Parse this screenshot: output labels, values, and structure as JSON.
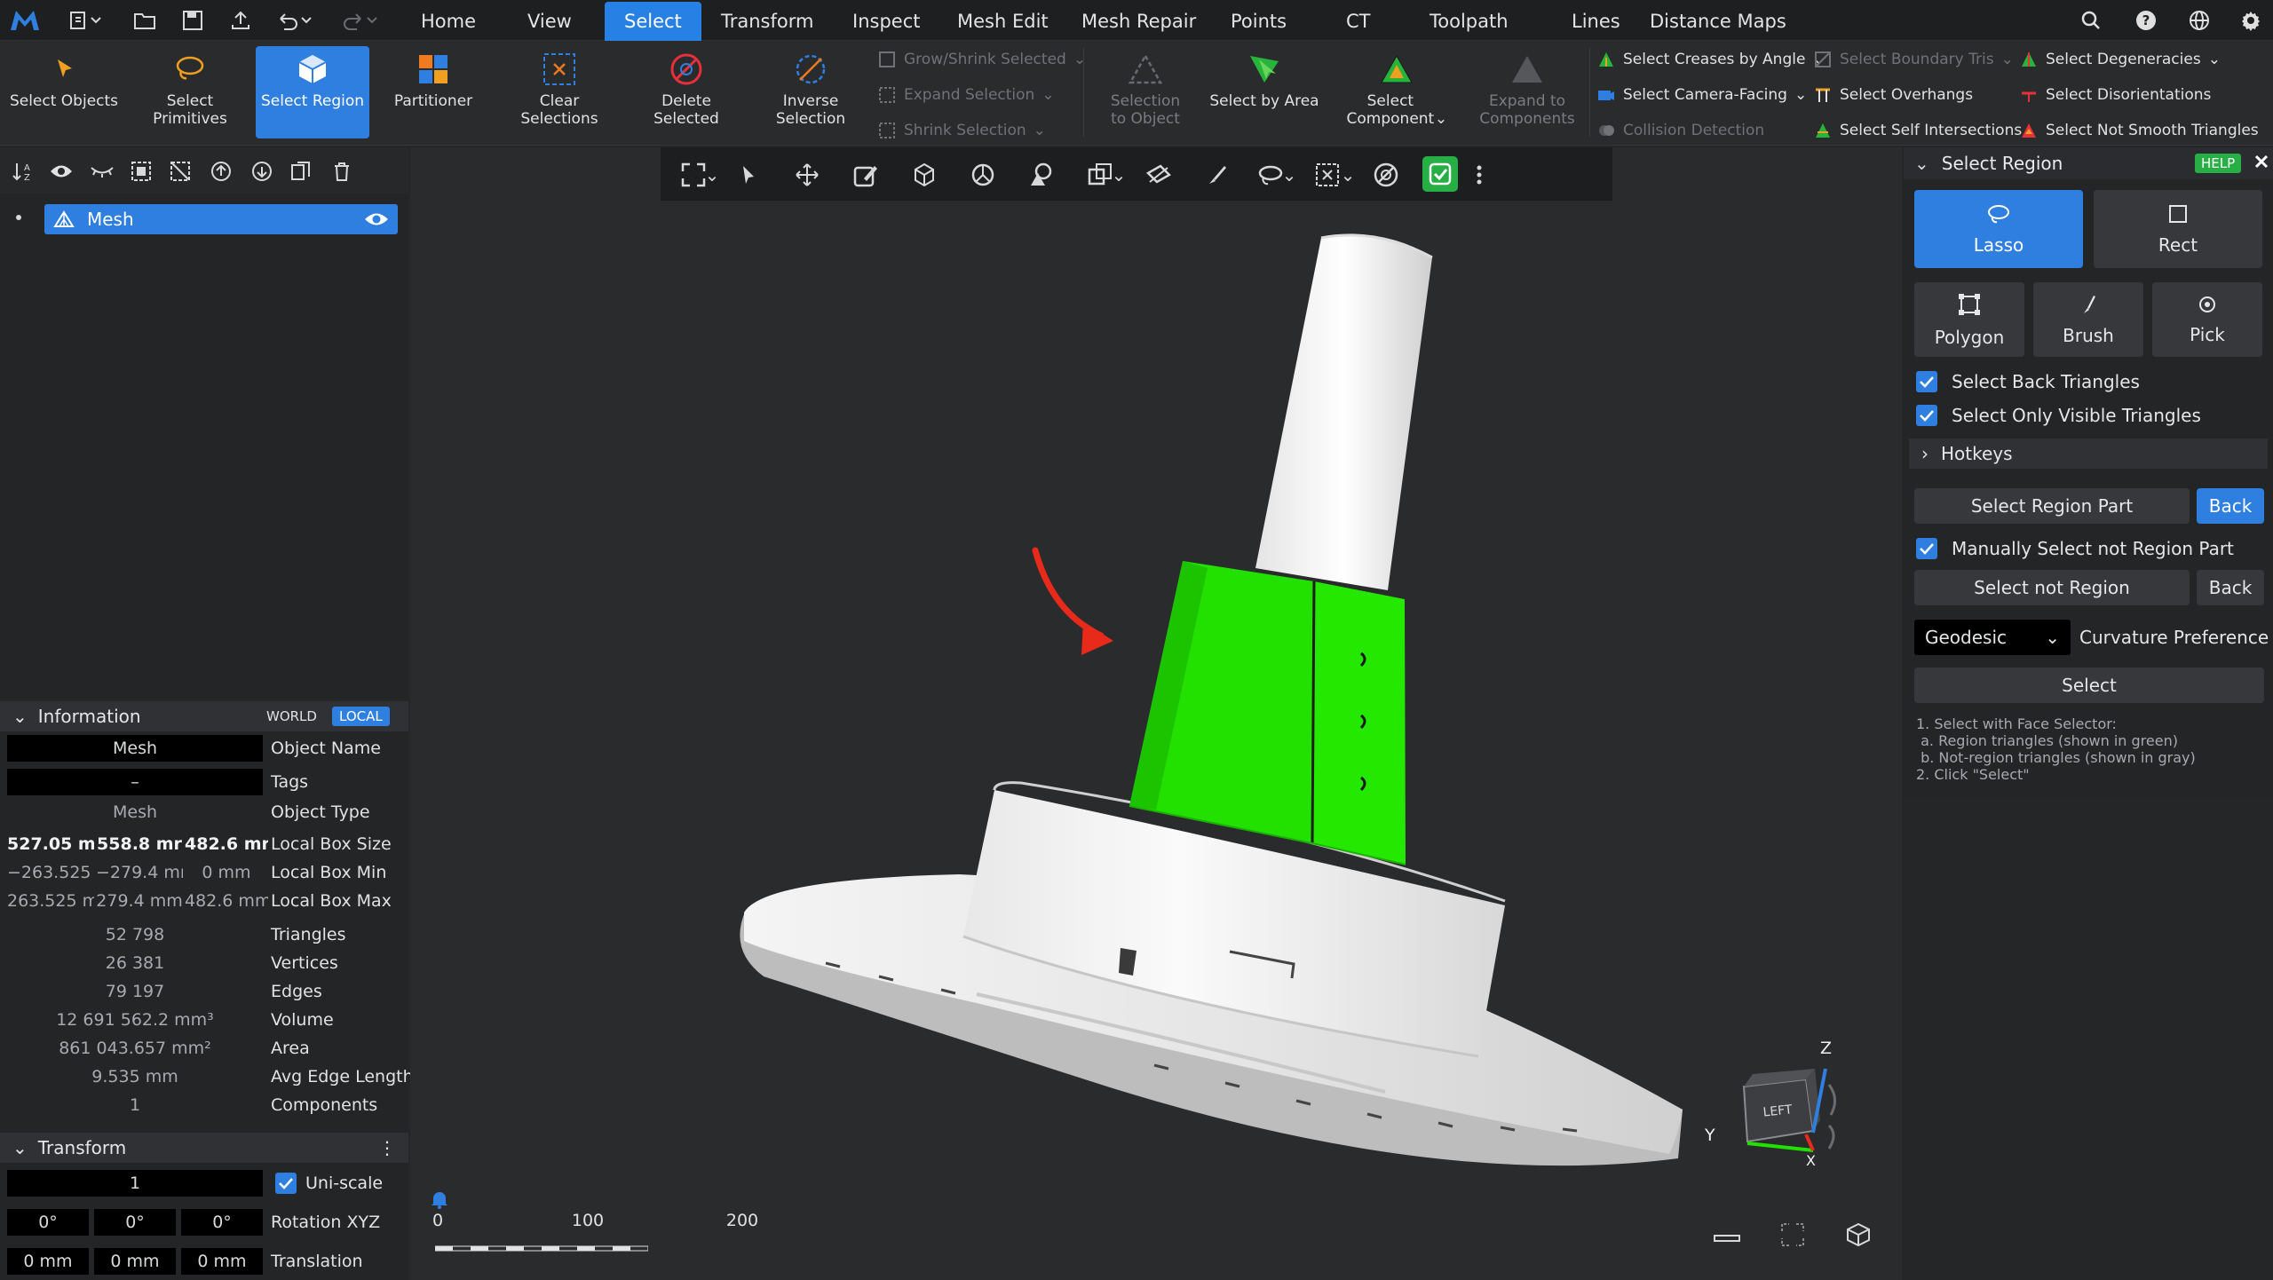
{
  "menu": {
    "tabs": [
      "Home",
      "View",
      "Select",
      "Transform",
      "Inspect",
      "Mesh Edit",
      "Mesh Repair",
      "Points",
      "CT",
      "Toolpath",
      "Lines",
      "Distance Maps"
    ],
    "active": "Select"
  },
  "ribbon": {
    "select_objects": "Select Objects",
    "select_primitives": "Select Primitives",
    "select_region": "Select Region",
    "partitioner": "Partitioner",
    "clear_selections": "Clear Selections",
    "delete_selected": "Delete Selected",
    "inverse_selection": "Inverse Selection",
    "grow_shrink": "Grow/Shrink Selected",
    "expand_selection": "Expand Selection",
    "shrink_selection": "Shrink Selection",
    "selection_to_object": "Selection to Object",
    "select_by_area": "Select by Area",
    "select_component": "Select Component",
    "expand_to_components": "Expand to Components",
    "select_creases": "Select Creases by Angle",
    "select_camera_facing": "Select Camera-Facing",
    "collision_detection": "Collision Detection",
    "select_boundary_tris": "Select Boundary Tris",
    "select_overhangs": "Select Overhangs",
    "select_self_intersections": "Select Self Intersections",
    "select_degeneracies": "Select Degeneracies",
    "select_disorientations": "Select Disorientations",
    "select_not_smooth": "Select Not Smooth Triangles"
  },
  "scene": {
    "items": [
      {
        "label": "Mesh"
      }
    ]
  },
  "info": {
    "title": "Information",
    "world": "WORLD",
    "local": "LOCAL",
    "object_name_value": "Mesh",
    "object_name_label": "Object Name",
    "tags_value": "–",
    "tags_label": "Tags",
    "object_type_value": "Mesh",
    "object_type_label": "Object Type",
    "box_size": [
      "527.05 mi",
      "558.8 mr",
      "482.6 mr"
    ],
    "box_size_label": "Local Box Size",
    "box_min": [
      "−263.525 r",
      "−279.4 mr",
      "0 mm"
    ],
    "box_min_label": "Local Box Min",
    "box_max": [
      "263.525 m",
      "279.4 mm",
      "482.6 mm"
    ],
    "box_max_label": "Local Box Max",
    "triangles": "52 798",
    "triangles_label": "Triangles",
    "vertices": "26 381",
    "vertices_label": "Vertices",
    "edges": "79 197",
    "edges_label": "Edges",
    "volume": "12 691 562.2 mm³",
    "volume_label": "Volume",
    "area": "861 043.657 mm²",
    "area_label": "Area",
    "avg_edge": "9.535 mm",
    "avg_edge_label": "Avg Edge Length",
    "components": "1",
    "components_label": "Components"
  },
  "transform": {
    "title": "Transform",
    "scale": "1",
    "uniscale": "Uni-scale",
    "rotation": [
      "0°",
      "0°",
      "0°"
    ],
    "rotation_label": "Rotation XYZ",
    "translation": [
      "0 mm",
      "0 mm",
      "0 mm"
    ],
    "translation_label": "Translation"
  },
  "panel": {
    "title": "Select Region",
    "help": "HELP",
    "lasso": "Lasso",
    "rect": "Rect",
    "polygon": "Polygon",
    "brush": "Brush",
    "pick": "Pick",
    "select_back": "Select Back Triangles",
    "select_visible": "Select Only Visible Triangles",
    "hotkeys": "Hotkeys",
    "select_region_part": "Select Region Part",
    "back1": "Back",
    "manual_not_region": "Manually Select not Region Part",
    "select_not_region": "Select not Region",
    "back2": "Back",
    "geodesic": "Geodesic",
    "curvature_pref": "Curvature Preference",
    "select": "Select",
    "help_lines": [
      "1. Select with Face Selector:",
      " a. Region triangles (shown in green)",
      " b. Not-region triangles (shown in gray)",
      "2. Click \"Select\""
    ]
  },
  "viewport": {
    "scale_labels": [
      "0",
      "100",
      "200"
    ],
    "axes": {
      "z": "Z",
      "y": "Y",
      "x": "X",
      "face": "LEFT"
    }
  },
  "colors": {
    "accent": "#2f7fe0",
    "selection": "#22e000",
    "arrow": "#e82a1a",
    "help_badge": "#27ae45"
  }
}
